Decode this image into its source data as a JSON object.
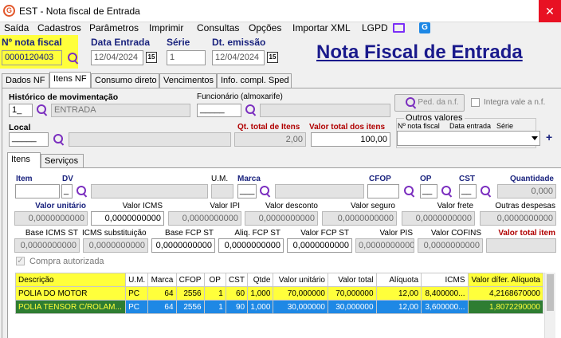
{
  "window": {
    "title": "EST - Nota fiscal de Entrada",
    "close": "✕",
    "logo": "G"
  },
  "menu": [
    "Saída",
    "Cadastros",
    "Parâmetros",
    "Imprimir",
    "Consultas",
    "Opções",
    "Importar XML",
    "LGPD"
  ],
  "header": {
    "nota_label": "Nº nota fiscal",
    "nota_value": "0000120403",
    "data_entrada_label": "Data Entrada",
    "data_entrada_value": "12/04/2024",
    "serie_label": "Série",
    "serie_value": "1",
    "dt_emissao_label": "Dt. emissão",
    "dt_emissao_value": "12/04/2024",
    "cal_label": "15",
    "page_title": "Nota Fiscal de Entrada"
  },
  "tabs": [
    "Dados NF",
    "Itens NF",
    "Consumo direto",
    "Vencimentos",
    "Info. compl. Sped"
  ],
  "itens_nf": {
    "historico_label": "Histórico de movimentação",
    "historico_code": "1_",
    "historico_desc": "ENTRADA",
    "funcionario_label": "Funcionário (almoxarife)",
    "funcionario_value": "_____",
    "ped_button": "Ped. da n.f.",
    "integra_label": "Integra vale a n.f.",
    "local_label": "Local",
    "local_value": "_____",
    "qt_total_label": "Qt. total de Itens",
    "qt_total_value": "2,00",
    "valor_total_label": "Valor total dos itens",
    "valor_total_value": "100,00",
    "outros_title": "Outros valores",
    "outros_cols": [
      "Nº nota fiscal",
      "Data entrada",
      "Série"
    ],
    "plus": "+"
  },
  "subtabs": [
    "Itens",
    "Serviços"
  ],
  "item_form": {
    "item_label": "Item",
    "dv_label": "DV",
    "dv_value": "_",
    "um_label": "U.M.",
    "marca_label": "Marca",
    "marca_value": "___",
    "cfop_label": "CFOP",
    "op_label": "OP",
    "op_value": "__",
    "cst_label": "CST",
    "cst_value": "__",
    "quantidade_label": "Quantidade",
    "quantidade_value": "0,000",
    "row2_labels": [
      "Valor unitário",
      "Valor ICMS",
      "Valor IPI",
      "Valor desconto",
      "Valor seguro",
      "Valor frete",
      "Outras despesas"
    ],
    "row2_values": [
      "0,0000000000",
      "0,0000000000",
      "0,0000000000",
      "0,0000000000",
      "0,0000000000",
      "0,0000000000",
      "0,0000000000"
    ],
    "row3_labels": [
      "Base ICMS ST",
      "ICMS substituição",
      "Base FCP ST",
      "Aliq. FCP ST",
      "Valor FCP ST",
      "Valor PIS",
      "Valor COFINS",
      "Valor total item"
    ],
    "row3_values": [
      "0,0000000000",
      "0,0000000000",
      "0,0000000000",
      "0,0000000000",
      "0,0000000000",
      "0,0000000000",
      "0,0000000000"
    ],
    "compra_autorizada": "Compra autorizada"
  },
  "table": {
    "headers": [
      "Descrição",
      "U.M.",
      "Marca",
      "CFOP",
      "OP",
      "CST",
      "Qtde",
      "Valor unitário",
      "Valor total",
      "Alíquota",
      "ICMS",
      "Valor dífer. Alíquota"
    ],
    "rows": [
      [
        "POLIA DO MOTOR",
        "PC",
        "64",
        "2556",
        "1",
        "60",
        "1,000",
        "70,000000",
        "70,000000",
        "12,00",
        "8,400000...",
        "4,2168670000"
      ],
      [
        "POLIA TENSOR C/ROLAM...",
        "PC",
        "64",
        "2556",
        "1",
        "90",
        "1,000",
        "30,000000",
        "30,000000",
        "12,00",
        "3,600000...",
        "1,8072290000"
      ]
    ]
  },
  "colors": {
    "highlight": "#ffff3b",
    "selection": "#1e88e5",
    "title": "#1a1a8c"
  }
}
